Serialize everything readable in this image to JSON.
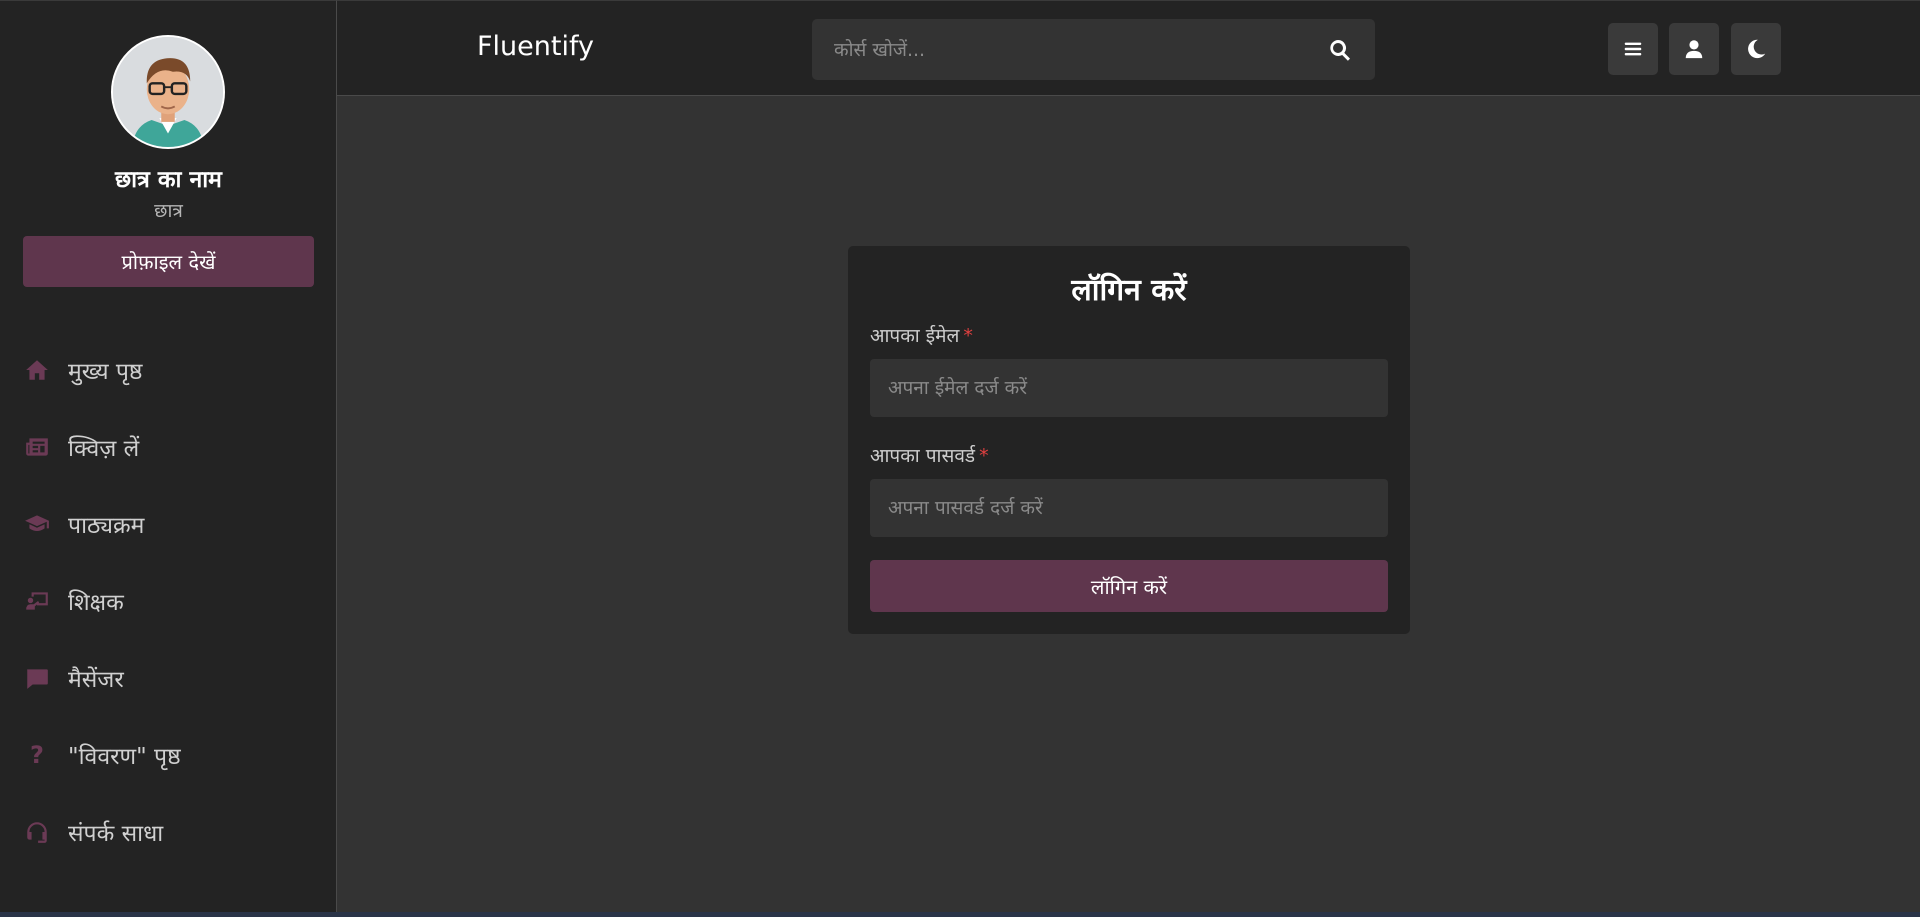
{
  "header": {
    "brand": "Fluentify",
    "search_placeholder": "कोर्स खोजें..."
  },
  "sidebar": {
    "student_name": "छात्र का नाम",
    "student_role": "छात्र",
    "profile_button": "प्रोफ़ाइल देखें",
    "items": [
      {
        "label": "मुख्य पृष्ठ",
        "icon": "home-icon"
      },
      {
        "label": "क्विज़ लें",
        "icon": "newspaper-icon"
      },
      {
        "label": "पाठ्यक्रम",
        "icon": "graduation-cap-icon"
      },
      {
        "label": "शिक्षक",
        "icon": "teacher-icon"
      },
      {
        "label": "मैसेंजर",
        "icon": "message-icon"
      },
      {
        "label": "\"विवरण\" पृष्ठ",
        "icon": "question-icon"
      },
      {
        "label": "संपर्क साधा",
        "icon": "headset-icon"
      }
    ]
  },
  "login": {
    "title": "लॉगिन करें",
    "email_label": "आपका ईमेल",
    "email_placeholder": "अपना ईमेल दर्ज करें",
    "password_label": "आपका पासवर्ड",
    "password_placeholder": "अपना पासवर्ड दर्ज करें",
    "required_mark": "*",
    "submit_label": "लॉगिन करें"
  },
  "colors": {
    "accent": "#5f364d",
    "icon_accent": "#6b3a55",
    "background": "#333333",
    "panel": "#232323",
    "required": "#e04040"
  }
}
